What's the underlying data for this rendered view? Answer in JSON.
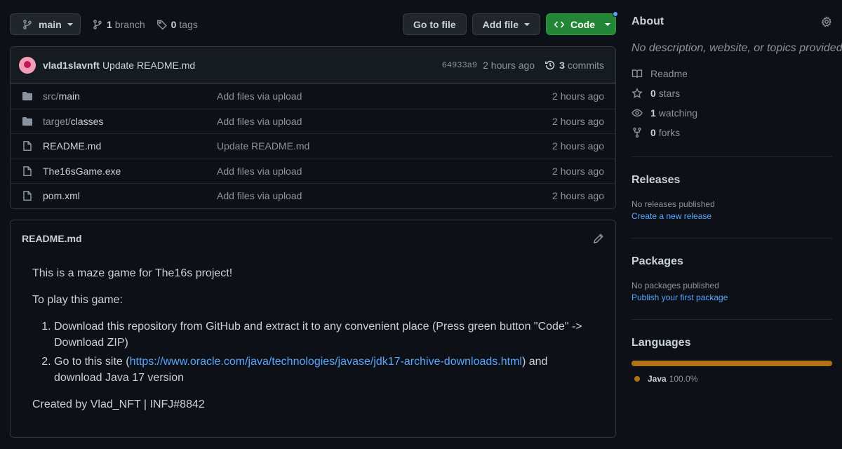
{
  "toolbar": {
    "branch_name": "main",
    "branch_count": "1",
    "branch_label": "branch",
    "tag_count": "0",
    "tag_label": "tags",
    "goto_label": "Go to file",
    "addfile_label": "Add file",
    "code_label": "Code"
  },
  "commit": {
    "author": "vlad1slavnft",
    "message": "Update README.md",
    "sha": "64933a9",
    "time": "2 hours ago",
    "commits_count": "3",
    "commits_label": "commits"
  },
  "files": [
    {
      "dir": "src/",
      "name": "main",
      "type": "folder",
      "message": "Add files via upload",
      "time": "2 hours ago"
    },
    {
      "dir": "target/",
      "name": "classes",
      "type": "folder",
      "message": "Add files via upload",
      "time": "2 hours ago"
    },
    {
      "dir": "",
      "name": "README.md",
      "type": "file",
      "message": "Update README.md",
      "time": "2 hours ago"
    },
    {
      "dir": "",
      "name": "The16sGame.exe",
      "type": "file",
      "message": "Add files via upload",
      "time": "2 hours ago"
    },
    {
      "dir": "",
      "name": "pom.xml",
      "type": "file",
      "message": "Add files via upload",
      "time": "2 hours ago"
    }
  ],
  "readme": {
    "title": "README.md",
    "intro": "This is a maze game for The16s project!",
    "play_heading": "To play this game:",
    "step1": "Download this repository from GitHub and extract it to any convenient place (Press green button \"Code\" -> Download ZIP)",
    "step2_before": "Go to this site (",
    "step2_link": "https://www.oracle.com/java/technologies/javase/jdk17-archive-downloads.html",
    "step2_after": ") and download Java 17 version",
    "footer": "Created by Vlad_NFT | INFJ#8842"
  },
  "about": {
    "title": "About",
    "description": "No description, website, or topics provided.",
    "readme_label": "Readme",
    "stars_count": "0",
    "stars_label": "stars",
    "watching_count": "1",
    "watching_label": "watching",
    "forks_count": "0",
    "forks_label": "forks"
  },
  "releases": {
    "title": "Releases",
    "empty": "No releases published",
    "link": "Create a new release"
  },
  "packages": {
    "title": "Packages",
    "empty": "No packages published",
    "link": "Publish your first package"
  },
  "languages": {
    "title": "Languages",
    "items": [
      {
        "name": "Java",
        "percent": "100.0%",
        "fraction": 1.0,
        "color": "#b07219"
      }
    ]
  },
  "colors": {
    "background": "#0d1117",
    "code_button": "#238636",
    "link": "#58a6ff",
    "java": "#b07219"
  }
}
